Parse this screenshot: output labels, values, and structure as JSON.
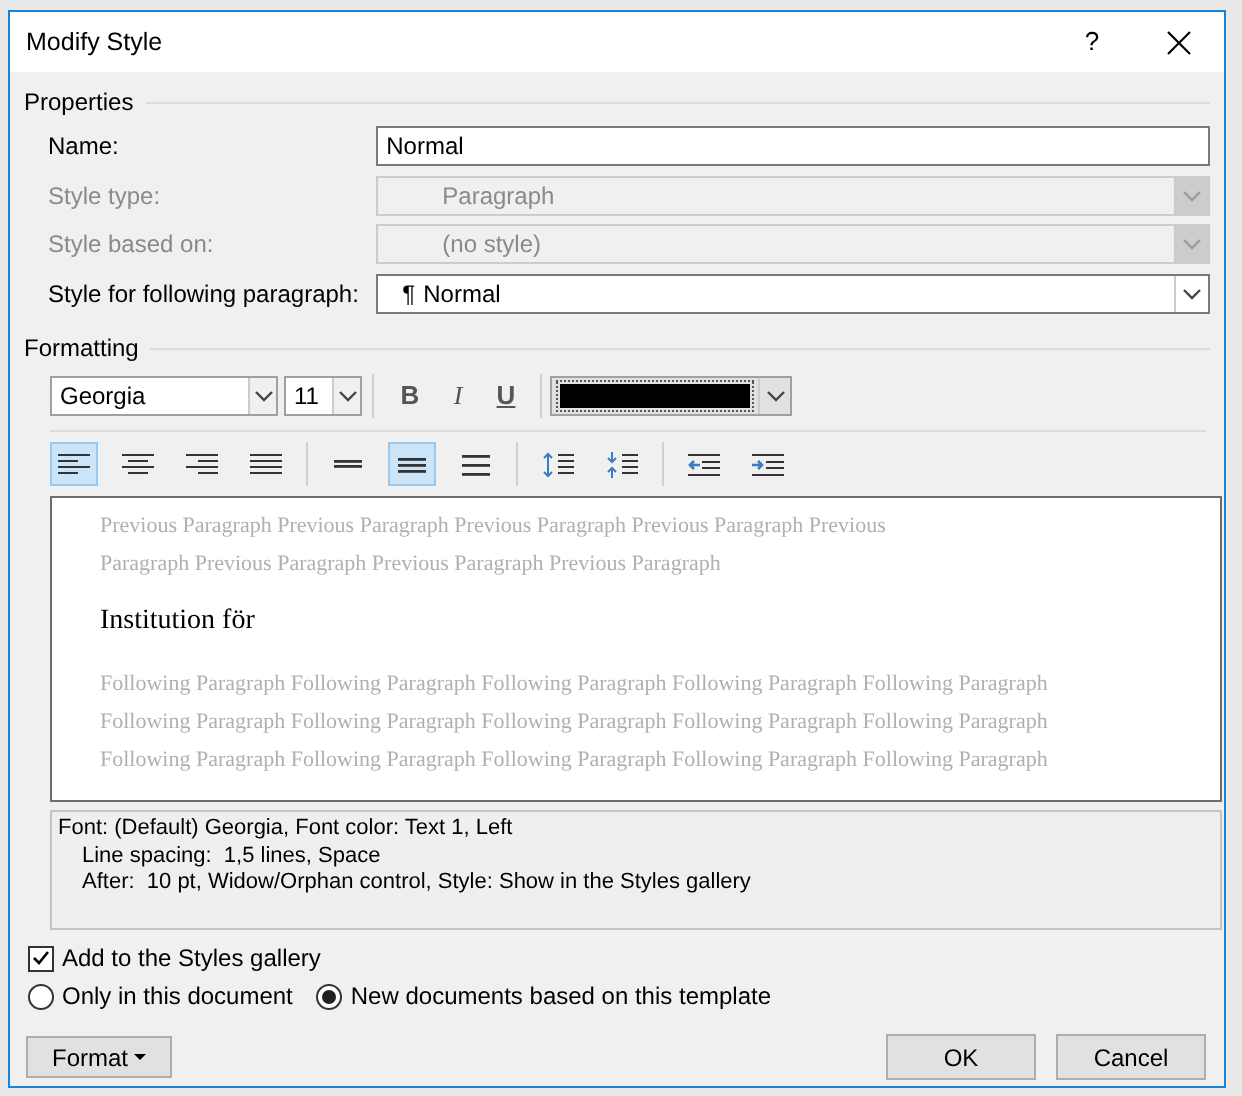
{
  "window": {
    "title": "Modify Style",
    "help": "?"
  },
  "properties": {
    "heading": "Properties",
    "fields": [
      {
        "label": "Name:",
        "value": "Normal",
        "kind": "text",
        "disabled": false
      },
      {
        "label": "Style type:",
        "value": "Paragraph",
        "kind": "select",
        "disabled": true
      },
      {
        "label": "Style based on:",
        "value": "(no style)",
        "kind": "select",
        "disabled": true
      },
      {
        "label": "Style for following paragraph:",
        "icon": "¶",
        "value": "Normal",
        "kind": "select",
        "disabled": false
      }
    ]
  },
  "formatting": {
    "heading": "Formatting",
    "font": "Georgia",
    "size": "11",
    "styles": [
      {
        "label": "B",
        "kind": "bold",
        "selected": false
      },
      {
        "label": "I",
        "kind": "italic",
        "selected": false
      },
      {
        "label": "U",
        "kind": "underline",
        "selected": false
      }
    ],
    "paragraph_buttons": [
      {
        "kind": "align-left",
        "selected": true
      },
      {
        "kind": "align-center",
        "selected": false
      },
      {
        "kind": "align-right",
        "selected": false
      },
      {
        "kind": "justify",
        "selected": false
      },
      {
        "kind": "single",
        "selected": false
      },
      {
        "kind": "one-half",
        "selected": true
      },
      {
        "kind": "double",
        "selected": false
      },
      {
        "kind": "space-more",
        "selected": false
      },
      {
        "kind": "space-less",
        "selected": false
      },
      {
        "kind": "outdent",
        "selected": false
      },
      {
        "kind": "indent",
        "selected": false
      }
    ]
  },
  "preview": {
    "previous": [
      "Previous Paragraph Previous Paragraph Previous Paragraph Previous Paragraph Previous",
      "Paragraph Previous Paragraph Previous Paragraph Previous Paragraph"
    ],
    "sample": "Institution för",
    "following": [
      "Following Paragraph Following Paragraph Following Paragraph Following Paragraph Following Paragraph",
      "Following Paragraph Following Paragraph Following Paragraph Following Paragraph Following Paragraph",
      "Following Paragraph Following Paragraph Following Paragraph Following Paragraph Following Paragraph"
    ]
  },
  "description": [
    "Font: (Default) Georgia, Font color: Text 1, Left",
    "Line spacing:  1,5 lines, Space",
    "After:  10 pt, Widow/Orphan control, Style: Show in the Styles gallery"
  ],
  "add_to_gallery": {
    "label": "Add to the Styles gallery",
    "checked": true
  },
  "scope": [
    {
      "label": "Only in this document",
      "selected": false
    },
    {
      "label": "New documents based on this template",
      "selected": true
    }
  ],
  "buttons": {
    "format": "Format",
    "ok": "OK",
    "cancel": "Cancel"
  }
}
